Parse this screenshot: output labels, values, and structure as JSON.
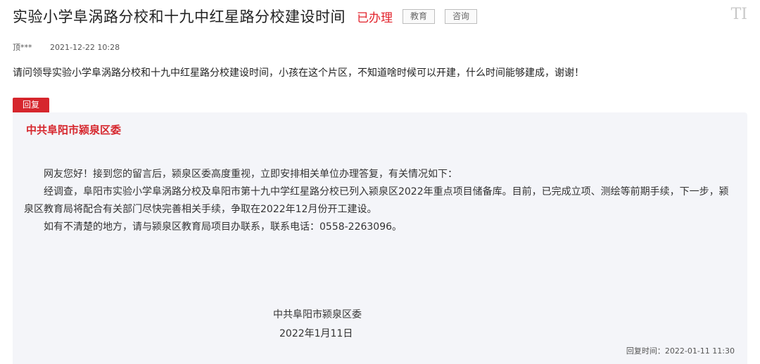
{
  "header": {
    "title": "实验小学阜涡路分校和十九中红星路分校建设时间",
    "status": "已办理",
    "tags": [
      "教育",
      "咨询"
    ],
    "font_icon_glyph": "TI"
  },
  "meta": {
    "author": "顶***",
    "date": "2021-12-22 10:28"
  },
  "question": "请问领导实验小学阜涡路分校和十九中红星路分校建设时间，小孩在这个片区，不知道啥时候可以开建，什么时间能够建成，谢谢！",
  "reply": {
    "badge": "回复",
    "department": "中共阜阳市颍泉区委",
    "paragraphs": [
      "网友您好！接到您的留言后，颍泉区委高度重视，立即安排相关单位办理答复，有关情况如下：",
      "经调查，阜阳市实验小学阜涡路分校及阜阳市第十九中学红星路分校已列入颍泉区2022年重点项目储备库。目前，已完成立项、测绘等前期手续，下一步，颍泉区教育局将配合有关部门尽快完善相关手续，争取在2022年12月份开工建设。",
      "如有不清楚的地方，请与颍泉区教育局项目办联系，联系电话：0558-2263096。"
    ],
    "signature_org": "中共阜阳市颍泉区委",
    "signature_date": "2022年1月11日",
    "reply_time_label": "回复时间：",
    "reply_time": "2022-01-11 11:30"
  },
  "colors": {
    "accent_red": "#d6262d",
    "reply_bg": "#f4f5f9"
  }
}
